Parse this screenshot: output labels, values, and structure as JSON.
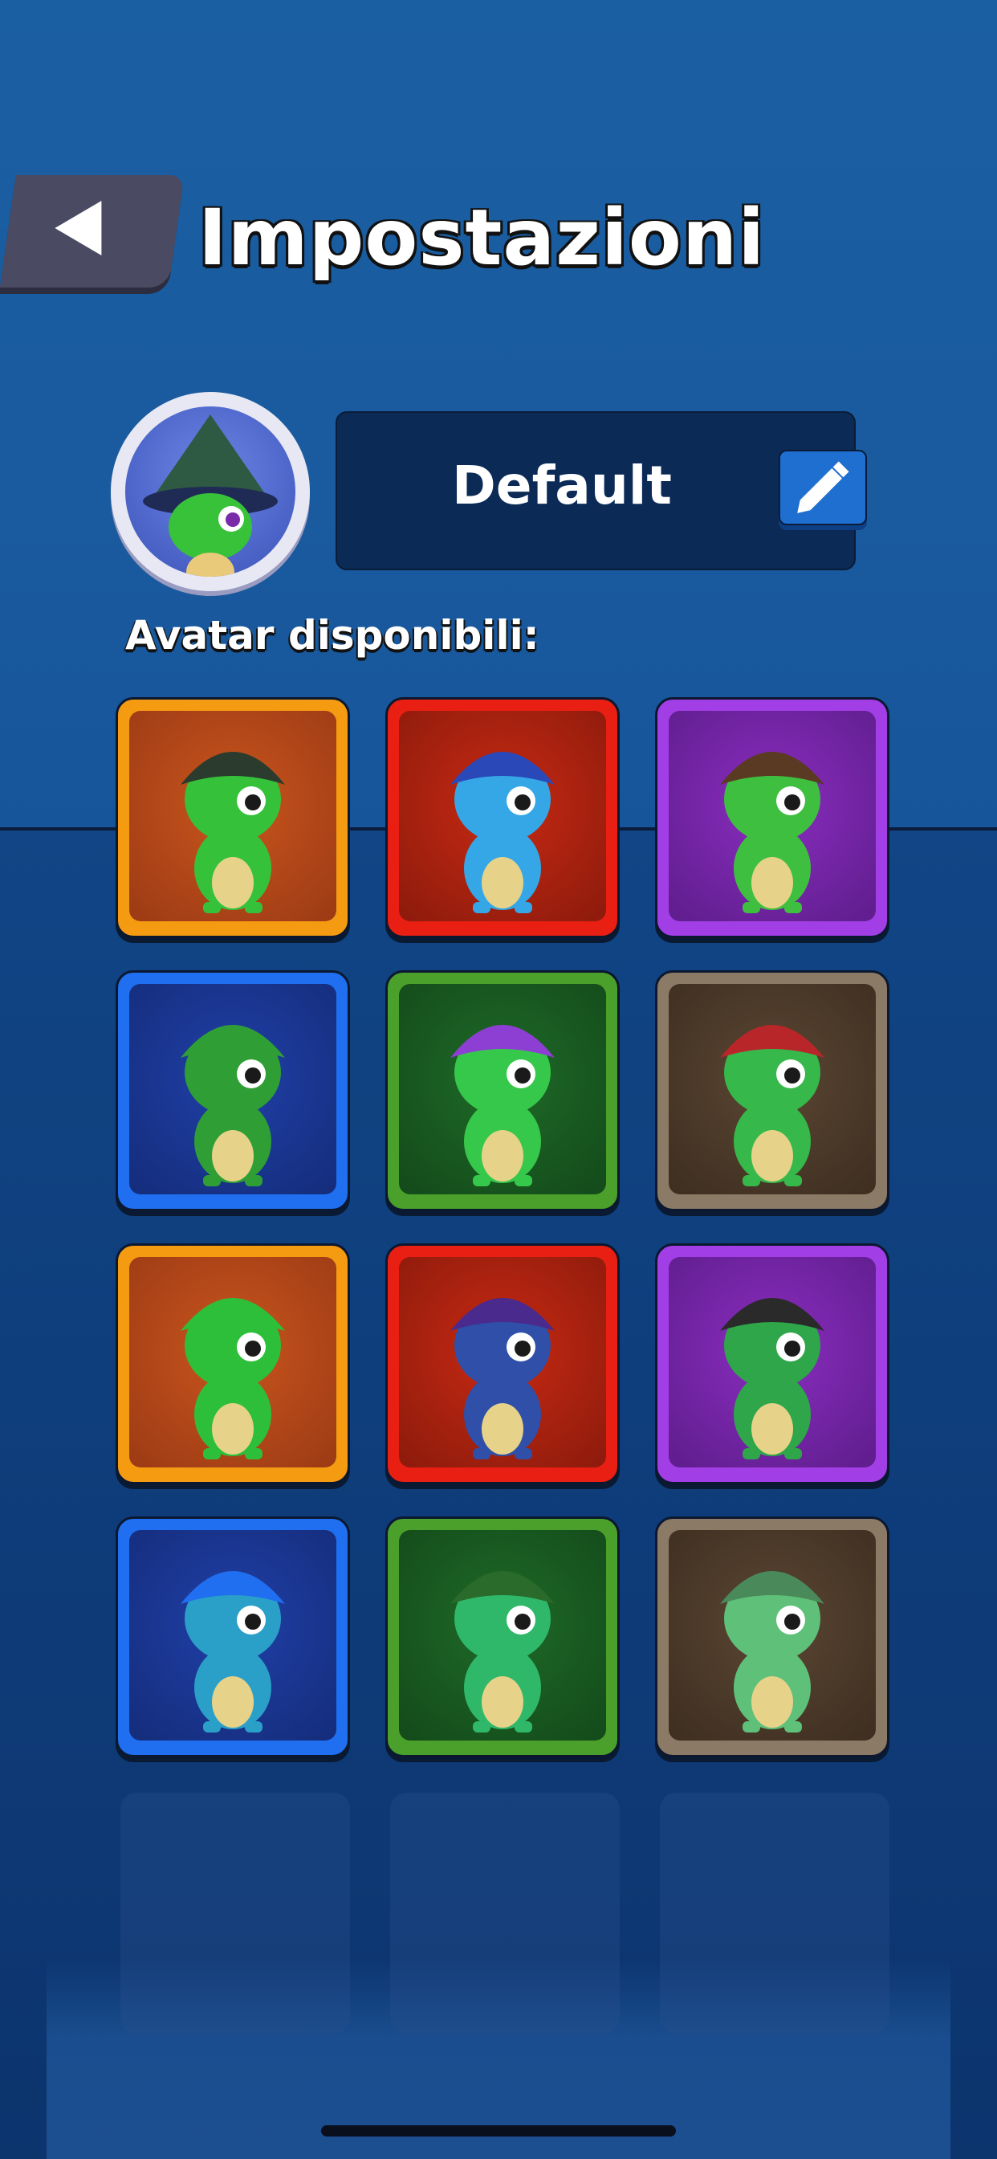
{
  "header": {
    "title": "Impostazioni",
    "back_icon": "back-triangle-icon"
  },
  "profile": {
    "name": "Default",
    "edit_icon": "pencil-icon",
    "avatar_icon": "lizard-avatar-icon"
  },
  "avatars": {
    "label": "Avatar disponibili:",
    "items": [
      {
        "id": "hooded-mage-lizard",
        "frame_color": "#f59b12"
      },
      {
        "id": "blue-hooded-lizard",
        "frame_color": "#e81f12"
      },
      {
        "id": "cowboy-lizard",
        "frame_color": "#a23ee6"
      },
      {
        "id": "spiky-lizard",
        "frame_color": "#1f6ff0"
      },
      {
        "id": "purple-hair-lizard",
        "frame_color": "#4aa02a"
      },
      {
        "id": "red-helmet-lizard",
        "frame_color": "#8b7a66"
      },
      {
        "id": "green-hood-lizard",
        "frame_color": "#f59b12"
      },
      {
        "id": "ninja-lizard",
        "frame_color": "#e81f12"
      },
      {
        "id": "pirate-lizard",
        "frame_color": "#a23ee6"
      },
      {
        "id": "robot-lizard",
        "frame_color": "#1f6ff0"
      },
      {
        "id": "vampire-lizard",
        "frame_color": "#4aa02a"
      },
      {
        "id": "white-hood-lizard",
        "frame_color": "#8b7a66"
      }
    ]
  }
}
